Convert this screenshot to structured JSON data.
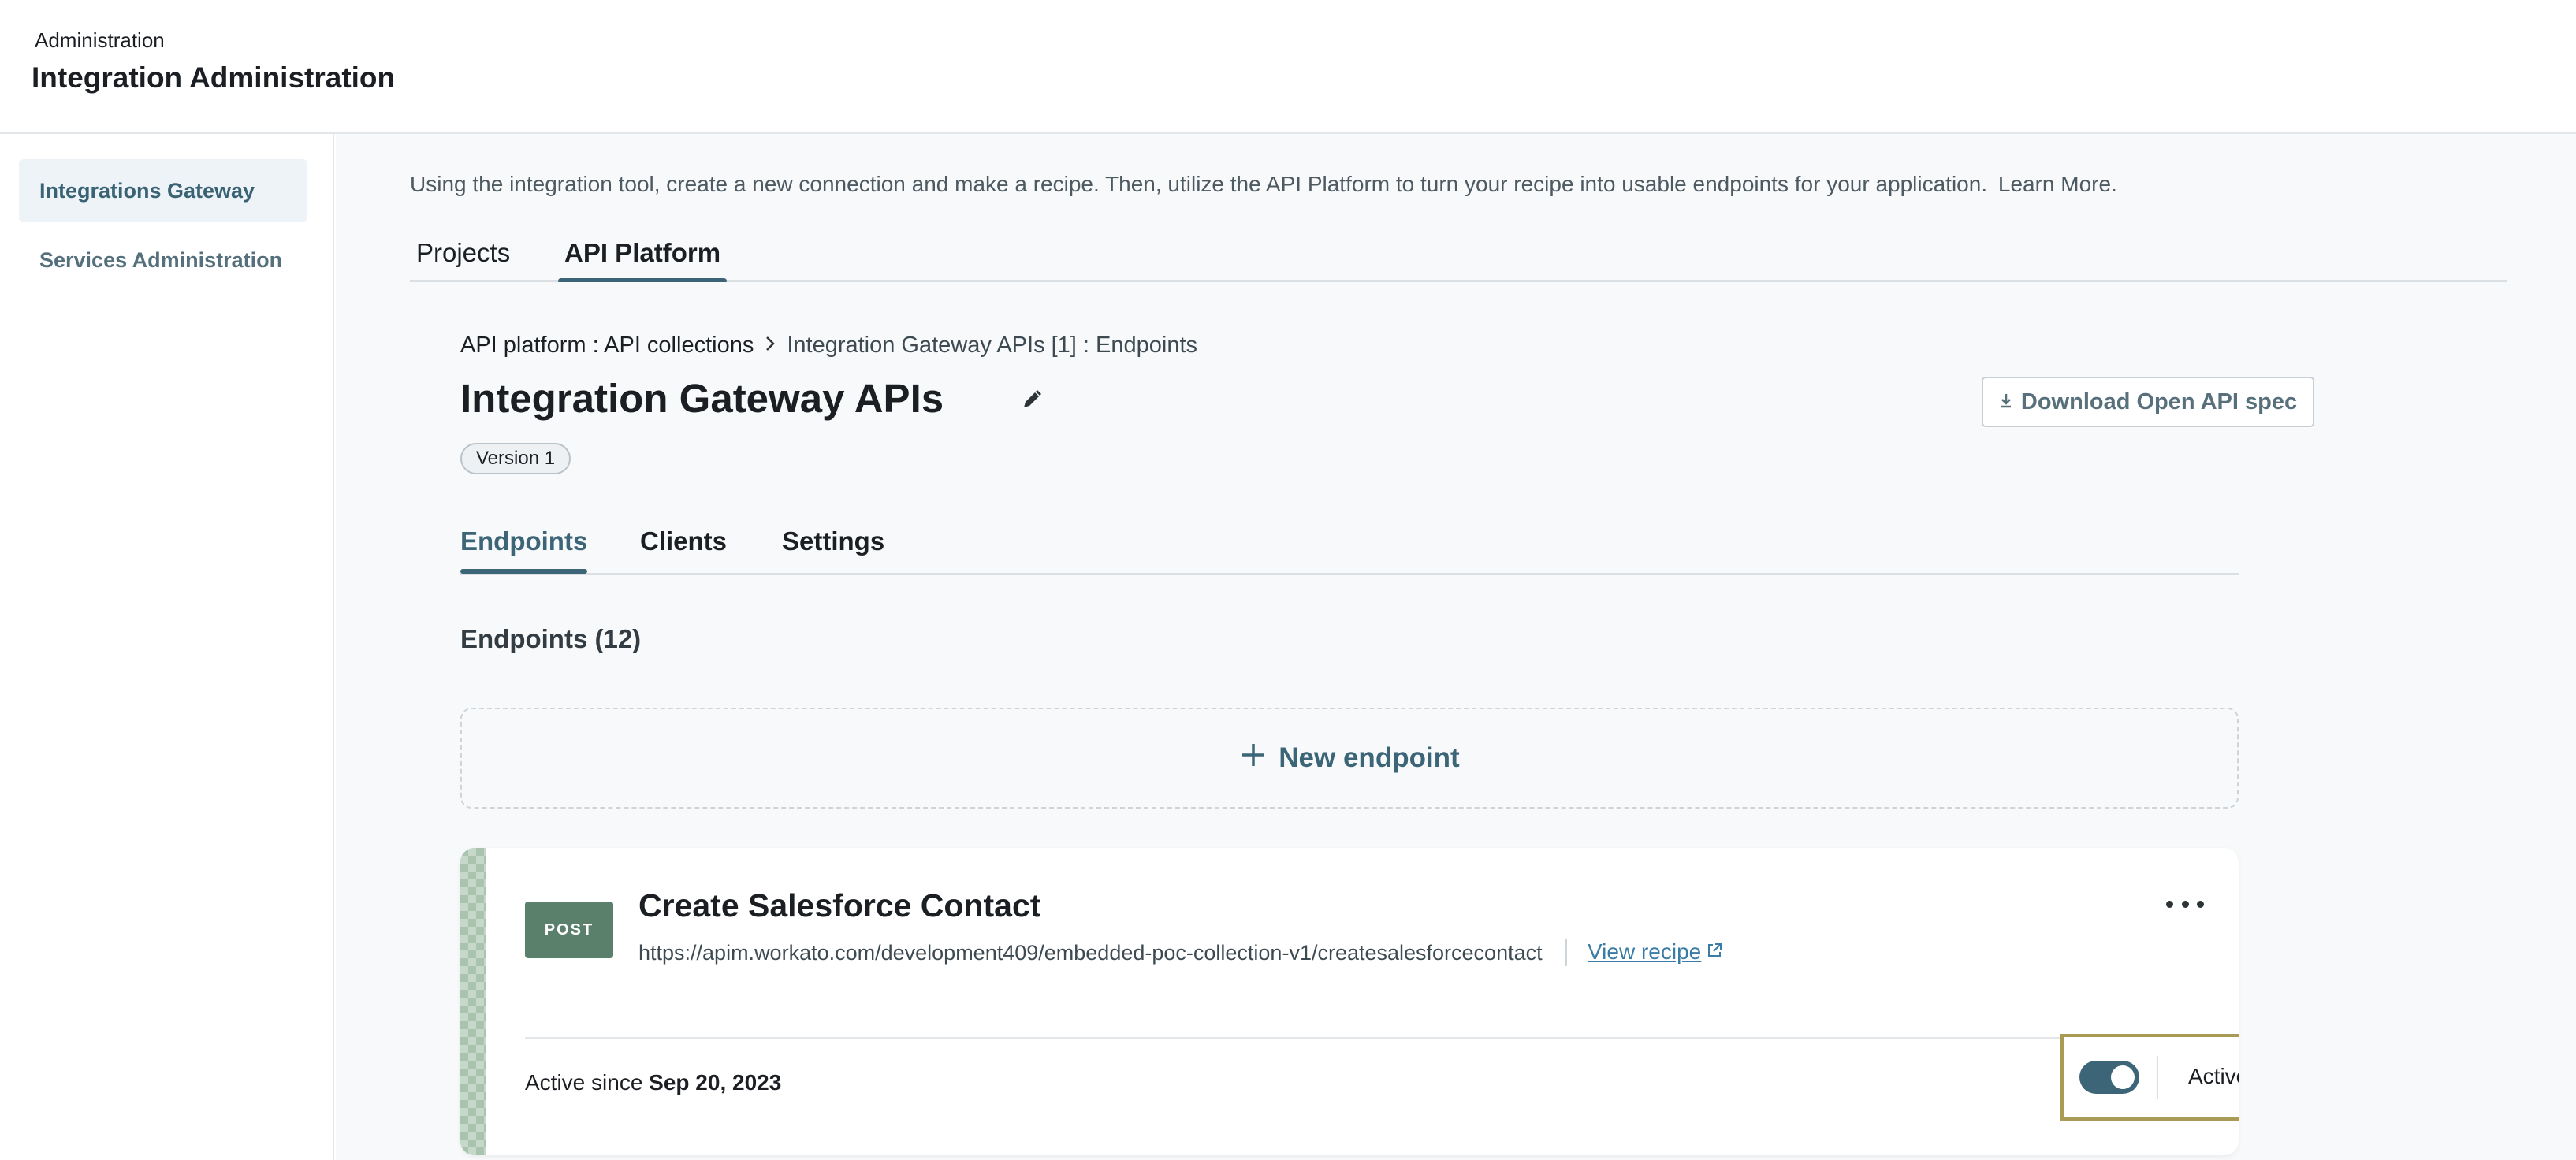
{
  "header": {
    "crumb": "Administration",
    "title": "Integration Administration"
  },
  "sidebar": {
    "items": [
      {
        "label": "Integrations Gateway",
        "active": true
      },
      {
        "label": "Services Administration",
        "active": false
      }
    ]
  },
  "main": {
    "intro_text": "Using the integration tool, create a new connection and make a recipe. Then, utilize the API Platform to turn your recipe into usable endpoints for your application.",
    "learn_more": "Learn More.",
    "tabs": [
      {
        "label": "Projects"
      },
      {
        "label": "API Platform"
      }
    ]
  },
  "collection": {
    "breadcrumb": {
      "root": "API platform : API collections",
      "current": "Integration Gateway APIs [1] : Endpoints"
    },
    "title": "Integration Gateway APIs",
    "version": "Version 1",
    "download_label": "Download Open API spec",
    "tabs": [
      {
        "label": "Endpoints"
      },
      {
        "label": "Clients"
      },
      {
        "label": "Settings"
      }
    ],
    "section_title": "Endpoints (12)",
    "new_endpoint_label": "New endpoint"
  },
  "endpoint": {
    "method": "POST",
    "name": "Create Salesforce Contact",
    "url": "https://apim.workato.com/development409/embedded-poc-collection-v1/createsalesforcecontact",
    "view_recipe": "View recipe",
    "active_since_prefix": "Active since",
    "active_since_date": "Sep 20, 2023",
    "status_label": "Active",
    "toggle_on": true
  },
  "colors": {
    "accent": "#3d6578",
    "method_post": "#5a7f6a",
    "highlight_border": "#a99b55",
    "link": "#3a7ca5"
  }
}
